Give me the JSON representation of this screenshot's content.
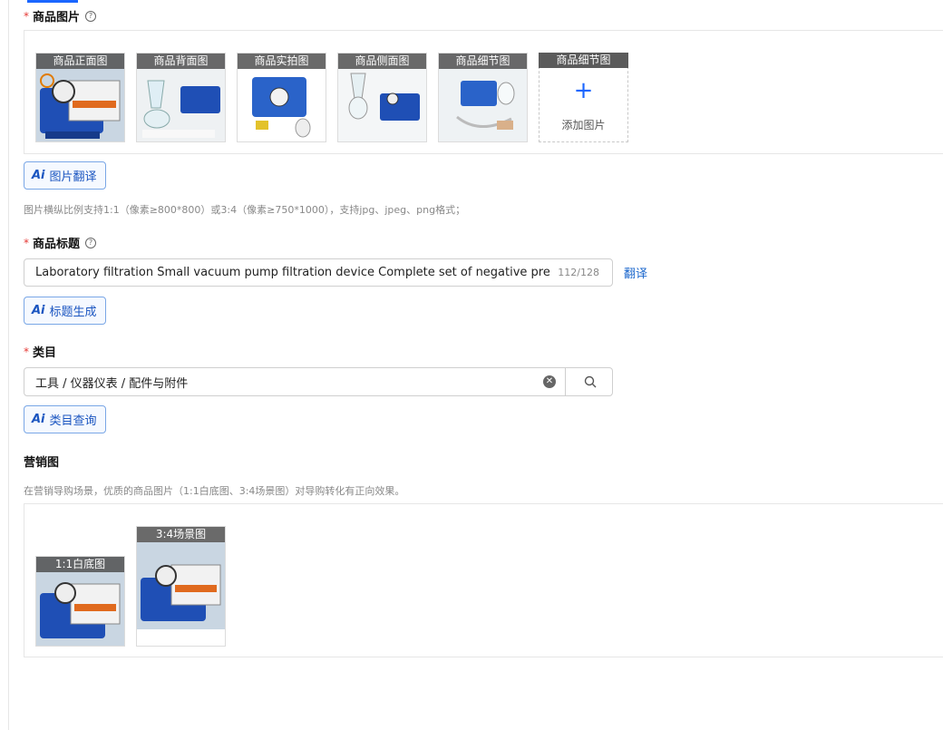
{
  "images_section": {
    "label": "商品图片",
    "required_mark": "*",
    "help_icon": "question-circle-icon",
    "thumbnails": [
      {
        "caption": "商品正面图"
      },
      {
        "caption": "商品背面图"
      },
      {
        "caption": "商品实拍图"
      },
      {
        "caption": "商品侧面图"
      },
      {
        "caption": "商品细节图"
      }
    ],
    "add_slot": {
      "caption": "商品细节图",
      "plus_icon": "plus-icon",
      "label": "添加图片"
    },
    "ai_button": {
      "icon": "ai-icon",
      "label": "图片翻译"
    },
    "hint": "图片横纵比例支持1:1（像素≥800*800）或3:4（像素≥750*1000），支持jpg、jpeg、png格式；"
  },
  "title_section": {
    "label": "商品标题",
    "required_mark": "*",
    "help_icon": "question-circle-icon",
    "value": "Laboratory filtration Small vacuum pump filtration device Complete set of negative pressure",
    "count": "112/128",
    "translate_link": "翻译",
    "ai_button": {
      "icon": "ai-icon",
      "label": "标题生成"
    }
  },
  "category_section": {
    "label": "类目",
    "required_mark": "*",
    "value": "工具 / 仪器仪表 / 配件与附件",
    "clear_icon": "clear-icon",
    "search_icon": "search-icon",
    "ai_button": {
      "icon": "ai-icon",
      "label": "类目查询"
    }
  },
  "marketing_section": {
    "label": "营销图",
    "hint": "在营销导购场景，优质的商品图片（1:1白底图、3:4场景图）对导购转化有正向效果。",
    "thumbnails": [
      {
        "caption": "1:1白底图"
      },
      {
        "caption": "3:4场景图"
      }
    ]
  },
  "colors": {
    "accent": "#1a66ff",
    "required": "#e53935",
    "link": "#1a66cc"
  }
}
